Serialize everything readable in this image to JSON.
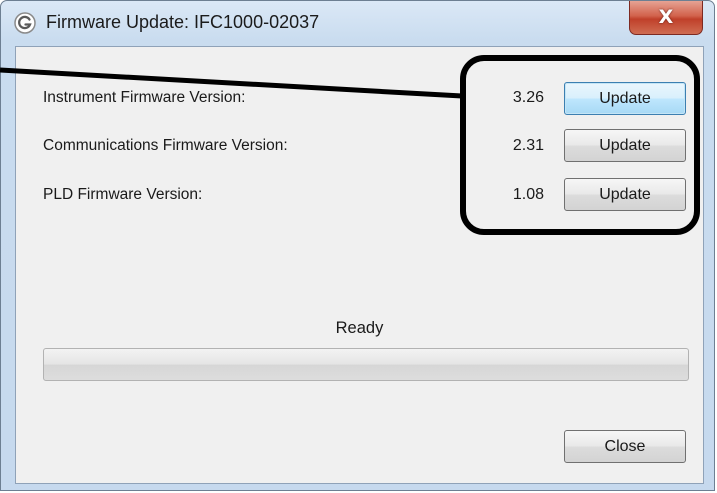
{
  "window": {
    "title": "Firmware Update: IFC1000-02037",
    "icon": "g-logo-icon",
    "close_glyph": "X"
  },
  "firmware": [
    {
      "label": "Instrument Firmware Version:",
      "version": "3.26",
      "button": "Update",
      "focused": true
    },
    {
      "label": "Communications Firmware Version:",
      "version": "2.31",
      "button": "Update",
      "focused": false
    },
    {
      "label": "PLD Firmware Version:",
      "version": "1.08",
      "button": "Update",
      "focused": false
    }
  ],
  "status": {
    "text": "Ready",
    "progress_percent": 0
  },
  "footer": {
    "close_label": "Close"
  },
  "colors": {
    "title_gradient_top": "#dbe8f6",
    "client_bg": "#f0f0f0",
    "close_x_red": "#c0402a",
    "callout": "#000000"
  }
}
